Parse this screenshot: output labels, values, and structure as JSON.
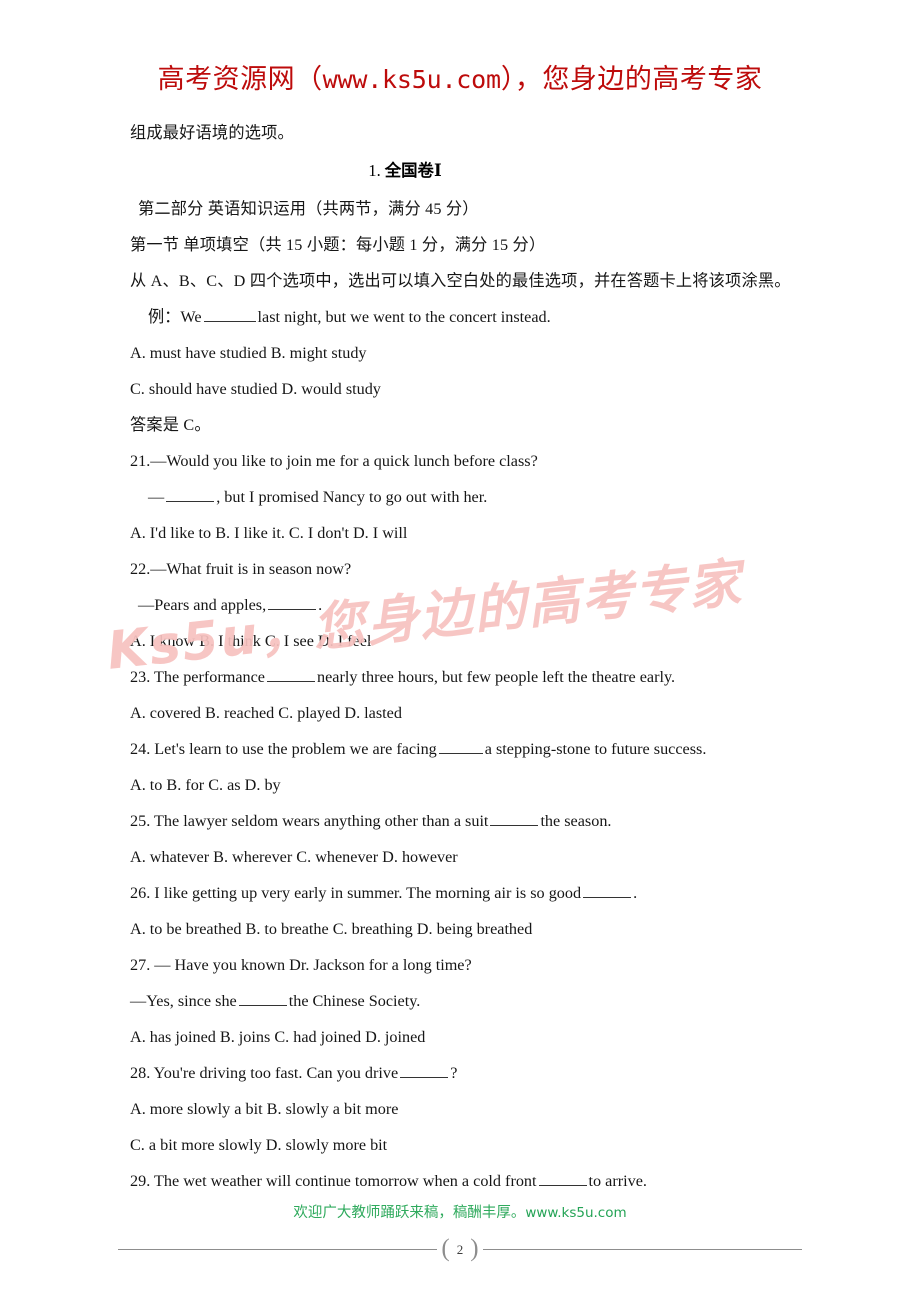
{
  "header": {
    "brand": "高考资源网",
    "open_paren": "（",
    "url": "www.ks5u.com",
    "close_paren": "）",
    "tagline": "，您身边的高考专家",
    "color": "#bd0b0b"
  },
  "watermark": {
    "text": "Ks5u，您身边的高考专家",
    "color": "#f7c2c0"
  },
  "body": {
    "intro_line": "组成最好语境的选项。",
    "section_number": "1.",
    "section_title": "全国卷Ⅰ",
    "part_two": "第二部分 英语知识运用（共两节，满分 45 分）",
    "section_one": "第一节 单项填空（共 15 小题：每小题 1 分，满分 15 分）",
    "instruction": "从 A、B、C、D 四个选项中，选出可以填入空白处的最佳选项，并在答题卡上将该项涂黑。",
    "example_prefix": "例：We",
    "example_suffix": "last night, but we went to the concert instead.",
    "example_options_line1": "A. must have studied            B. might study",
    "example_options_line2": "C. should have studied             D. would study",
    "example_answer": "答案是 C。"
  },
  "questions": [
    {
      "id": "21",
      "stem": "21.—Would you like to join me for a quick lunch before class?",
      "reply_prefix": "—",
      "reply_suffix": ", but I promised Nancy to go out with her.",
      "options_lines": [
        "A. I'd like to   B. I like it.   C. I don't   D. I will"
      ]
    },
    {
      "id": "22",
      "stem": "22.—What fruit is in season now?",
      "reply_prefix": "—Pears and apples,",
      "reply_suffix": ".",
      "options_lines": [
        "A. I know   B. I think   C. I see   D. I feel"
      ]
    },
    {
      "id": "23",
      "stem_prefix": "23. The performance",
      "stem_suffix": "nearly three hours, but few people left the theatre early.",
      "options_lines": [
        "A. covered   B. reached   C. played   D. lasted"
      ]
    },
    {
      "id": "24",
      "stem_prefix": "24. Let's learn to use the problem we are facing",
      "stem_suffix": "a stepping-stone to future success.",
      "options_lines": [
        "A. to   B. for   C. as    D. by"
      ]
    },
    {
      "id": "25",
      "stem_prefix": "25. The lawyer seldom wears anything other than a suit",
      "stem_suffix": "the season.",
      "options_lines": [
        "A. whatever   B. wherever   C. whenever   D. however"
      ]
    },
    {
      "id": "26",
      "stem_prefix": "26. I like getting up very early in summer. The morning air is so good",
      "stem_suffix": ".",
      "options_lines": [
        "A. to be breathed   B. to breathe   C. breathing   D. being breathed"
      ]
    },
    {
      "id": "27",
      "stem": "27. — Have you known Dr. Jackson for a long time?",
      "reply_prefix": "—Yes, since she",
      "reply_suffix": "the Chinese Society.",
      "options_lines": [
        "A. has joined   B. joins   C. had joined   D. joined"
      ]
    },
    {
      "id": "28",
      "stem_prefix": "28. You're driving too fast. Can you drive",
      "stem_suffix": "?",
      "options_lines": [
        "A. more slowly a bit     B. slowly a bit more",
        "C. a bit more slowly     D. slowly more bit"
      ]
    },
    {
      "id": "29",
      "stem_prefix": "29. The wet weather will continue tomorrow when a cold front",
      "stem_suffix": "to arrive.",
      "options_lines": []
    }
  ],
  "footer": {
    "promo": "欢迎广大教师踊跃来稿，稿酬丰厚。",
    "site": "www.ks5u.com",
    "page_number": "2",
    "brace_left": "(",
    "brace_right": ")",
    "color": "#2faa5d"
  }
}
